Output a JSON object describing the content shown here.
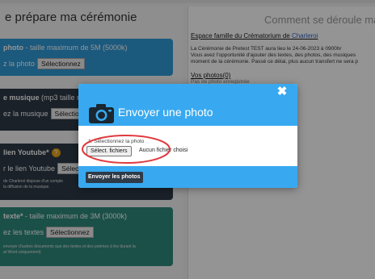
{
  "background": {
    "left_title": "e prépare ma cérémonie",
    "right_title": "Comment se déroule ma cér",
    "cards": [
      {
        "title_bold": "photo",
        "title_rest": " - taille maximum de 5M (5000k)",
        "row_text": "z la photo",
        "button_label": "Sélectionnez"
      },
      {
        "title_bold": "e musique",
        "title_rest": " (mp3 taille ma",
        "row_text": "ez la musique",
        "button_label": "Sélection"
      },
      {
        "title_bold": "lien Youtube*",
        "badge": "?",
        "row_text": "r le lien Youtube",
        "button_label": "Sélect",
        "note_1": "de Charleroi dispose d'un comple",
        "note_2": "la diffusion de la musique."
      },
      {
        "title_bold": "texte*",
        "title_rest": " - taille maximum de 3M (3000k)",
        "row_text": "ez les textes",
        "button_label": "Sélectionnez",
        "note_1": "envoyer d'autres documents que des textes et des poèmes à lire durant la",
        "note_2": "at Word uniquement)"
      }
    ],
    "right_panel": {
      "link_prefix": "Espace famille du Crématorium de ",
      "link_city": "Charleroi",
      "line_1": "La Cérémonie de Pretest TEST aura lieu le 24-06-2023 à 0900hr",
      "line_2": "Vous avez l'opportunité d'ajouter des textes, des photos, des musiques",
      "line_3": "moment de la cérémonie. Passé ce délai, plus aucun transfert ne sera p",
      "photos_label": "Vos photos",
      "photos_count": "(0)",
      "faded_line": "Pas de photo enregistrée"
    }
  },
  "modal": {
    "title": "Envoyer une photo",
    "close_glyph": "✖",
    "step_label": "1. Sélectionnez la photo",
    "file_button_label": "Sélect. fichiers",
    "file_status": "Aucun fichier choisi",
    "submit_label": "Envoyer les photos"
  },
  "colors": {
    "modal_blue": "#38a9f0",
    "dark_button": "#2e3a47",
    "highlight_red": "#e0393e",
    "card_blue": "#2f9ad8",
    "card_teal": "#2f8a7d"
  },
  "icons": {
    "camera": "camera-icon",
    "close": "close-icon",
    "help": "help-icon"
  }
}
